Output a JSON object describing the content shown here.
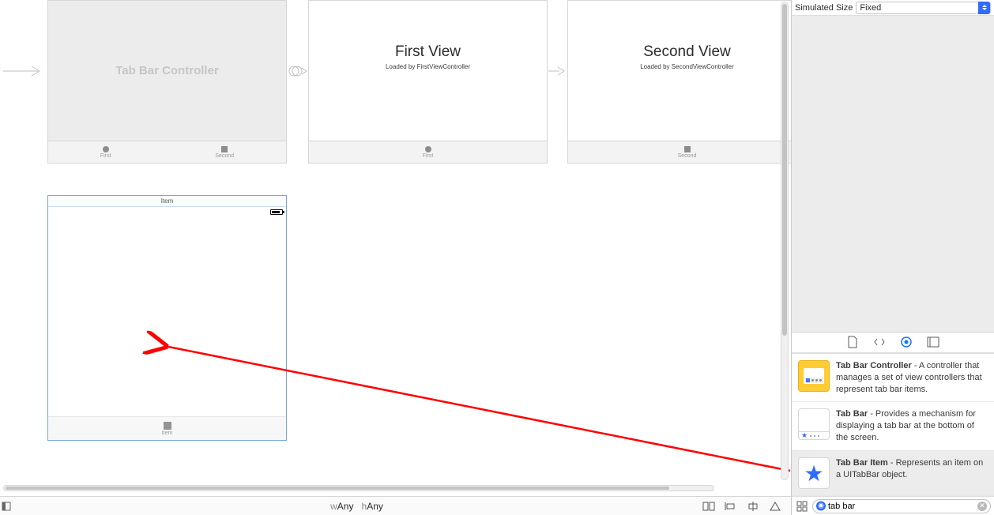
{
  "top_row": {
    "simulated_size_label": "Simulated Size",
    "simulated_size_value": "Fixed"
  },
  "canvas": {
    "tab_bar_controller_title": "Tab Bar Controller",
    "tbc_tabs": {
      "first": "First",
      "second": "Second"
    },
    "view1": {
      "title": "First View",
      "subtitle": "Loaded by FirstViewController",
      "tab_label": "First"
    },
    "view2": {
      "title": "Second View",
      "subtitle": "Loaded by SecondViewController",
      "tab_label": "Second"
    },
    "item_scene": {
      "header": "Item",
      "tab_label": "Item"
    }
  },
  "bottom_bar": {
    "w_prefix": "w",
    "w_value": "Any",
    "h_prefix": "h",
    "h_value": "Any"
  },
  "library": {
    "items": [
      {
        "title": "Tab Bar Controller",
        "desc": " - A controller that manages a set of view controllers that represent tab bar items."
      },
      {
        "title": "Tab Bar",
        "desc": " - Provides a mechanism for displaying a tab bar at the bottom of the screen."
      },
      {
        "title": "Tab Bar Item",
        "desc": " - Represents an item on a UITabBar object."
      }
    ],
    "search_value": "tab bar"
  }
}
